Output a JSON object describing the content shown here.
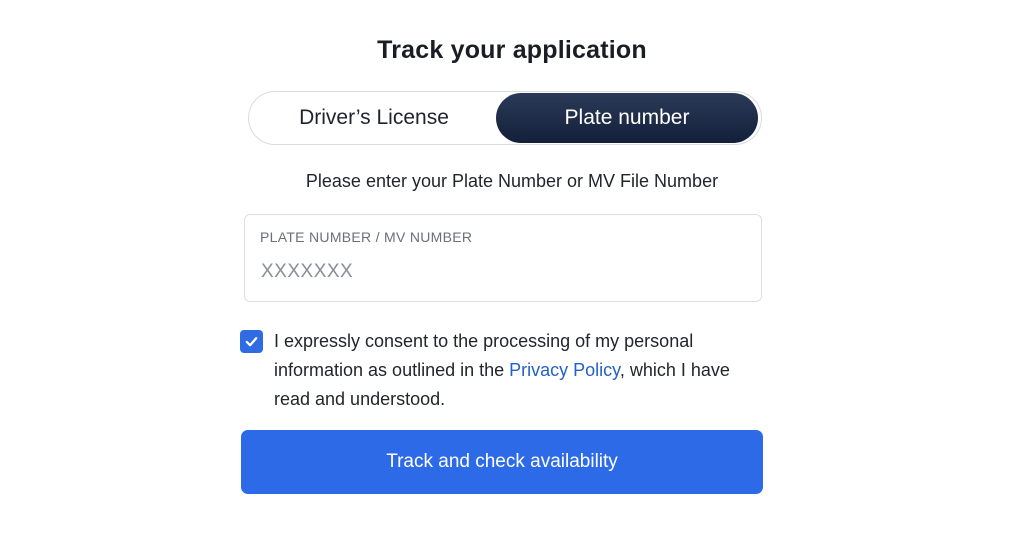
{
  "page": {
    "title": "Track your application"
  },
  "toggle": {
    "tabs": [
      {
        "label": "Driver’s License",
        "selected": false
      },
      {
        "label": "Plate number",
        "selected": true
      }
    ]
  },
  "form": {
    "instruction": "Please enter your Plate Number or MV File Number",
    "field_label": "PLATE NUMBER / MV NUMBER",
    "field_placeholder": "XXXXXXX",
    "field_value": ""
  },
  "consent": {
    "checked": true,
    "text_before": "I expressly consent to the processing of my personal information as outlined in the ",
    "link_text": "Privacy Policy",
    "text_after": ", which I have read and understood."
  },
  "actions": {
    "submit_label": "Track and check availability"
  },
  "colors": {
    "accent": "#2d6ae8",
    "selected_tab": "#1a2540",
    "link": "#2460c8"
  }
}
